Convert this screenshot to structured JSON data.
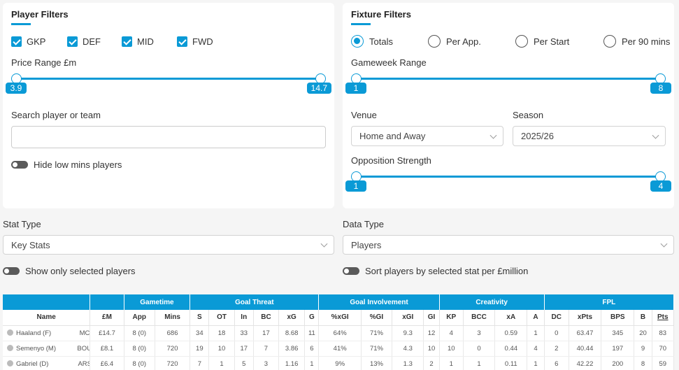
{
  "player_filters": {
    "title": "Player Filters",
    "positions": [
      {
        "label": "GKP",
        "checked": true
      },
      {
        "label": "DEF",
        "checked": true
      },
      {
        "label": "MID",
        "checked": true
      },
      {
        "label": "FWD",
        "checked": true
      }
    ],
    "price_label": "Price Range £m",
    "price_min": "3.9",
    "price_max": "14.7",
    "search_label": "Search player or team",
    "search_value": "",
    "hide_low_mins": "Hide low mins players"
  },
  "fixture_filters": {
    "title": "Fixture Filters",
    "modes": [
      {
        "label": "Totals",
        "selected": true
      },
      {
        "label": "Per App.",
        "selected": false
      },
      {
        "label": "Per Start",
        "selected": false
      },
      {
        "label": "Per 90 mins",
        "selected": false
      }
    ],
    "gw_label": "Gameweek Range",
    "gw_min": "1",
    "gw_max": "8",
    "venue_label": "Venue",
    "venue_value": "Home and Away",
    "season_label": "Season",
    "season_value": "2025/26",
    "opp_label": "Opposition Strength",
    "opp_min": "1",
    "opp_max": "4"
  },
  "stat_type": {
    "label": "Stat Type",
    "value": "Key Stats"
  },
  "data_type": {
    "label": "Data Type",
    "value": "Players"
  },
  "show_selected": "Show only selected players",
  "sort_by_price": "Sort players by selected stat per £million",
  "table": {
    "groups": [
      "Gametime",
      "Goal Threat",
      "Goal Involvement",
      "Creativity",
      "FPL"
    ],
    "headers": [
      "Name",
      "£M",
      "App",
      "Mins",
      "S",
      "OT",
      "In",
      "BC",
      "xG",
      "G",
      "%xGI",
      "%GI",
      "xGI",
      "GI",
      "KP",
      "BCC",
      "xA",
      "A",
      "DC",
      "xPts",
      "BPS",
      "B",
      "Pts"
    ],
    "rows": [
      {
        "name": "Haaland (F)",
        "team": "MCI",
        "cells": [
          "£14.7",
          "8 (0)",
          "686",
          "34",
          "18",
          "33",
          "17",
          "8.68",
          "11",
          "64%",
          "71%",
          "9.3",
          "12",
          "4",
          "3",
          "0.59",
          "1",
          "0",
          "63.47",
          "345",
          "20",
          "83"
        ]
      },
      {
        "name": "Semenyo (M)",
        "team": "BOU",
        "cells": [
          "£8.1",
          "8 (0)",
          "720",
          "19",
          "10",
          "17",
          "7",
          "3.86",
          "6",
          "41%",
          "71%",
          "4.3",
          "10",
          "10",
          "0",
          "0.44",
          "4",
          "2",
          "40.44",
          "197",
          "9",
          "70"
        ]
      },
      {
        "name": "Gabriel (D)",
        "team": "ARS",
        "cells": [
          "£6.4",
          "8 (0)",
          "720",
          "7",
          "1",
          "5",
          "3",
          "1.16",
          "1",
          "9%",
          "13%",
          "1.3",
          "2",
          "1",
          "1",
          "0.11",
          "1",
          "6",
          "42.22",
          "200",
          "8",
          "59"
        ]
      }
    ]
  },
  "colors": {
    "accent": "#0a9ad6"
  }
}
